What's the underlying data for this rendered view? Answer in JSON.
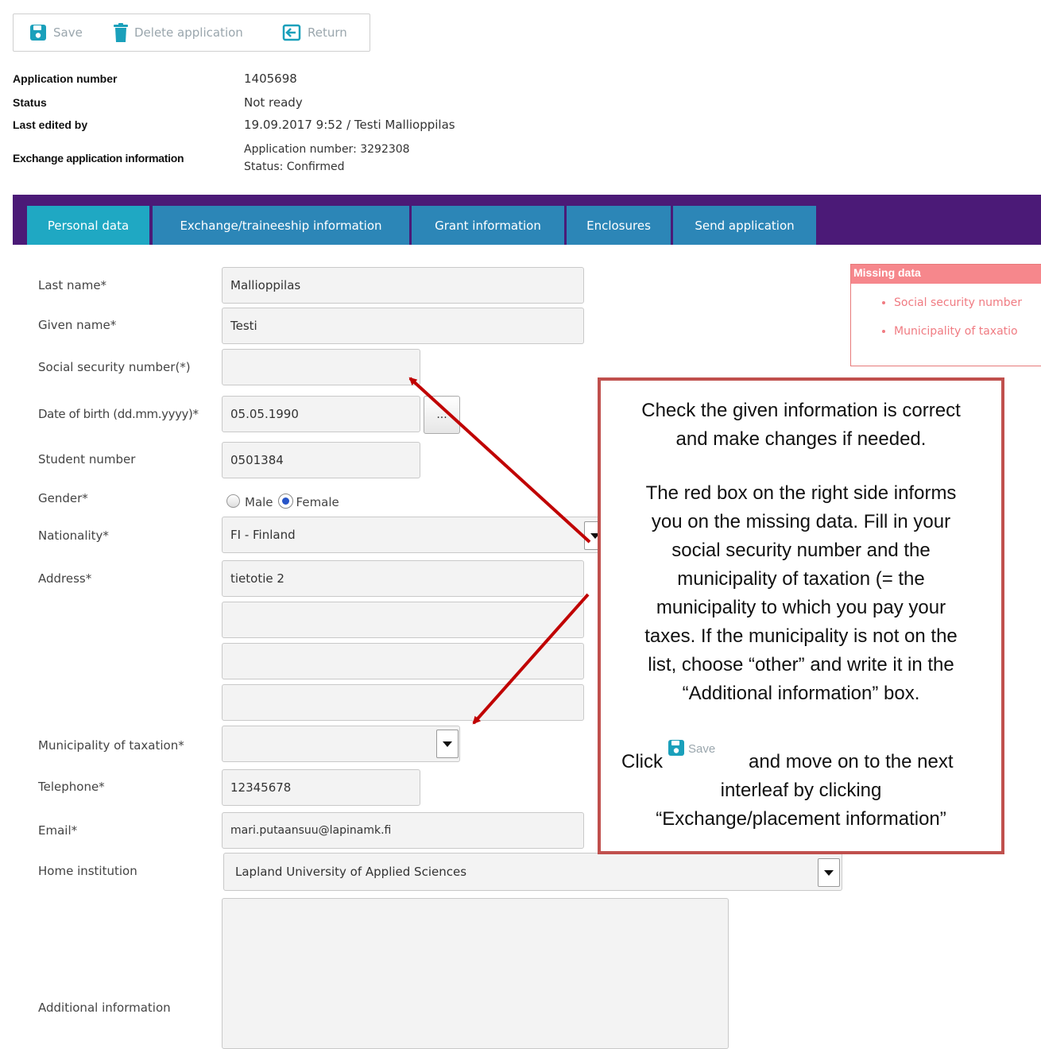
{
  "toolbar": {
    "save_label": "Save",
    "delete_label": "Delete application",
    "return_label": "Return"
  },
  "info": {
    "application_number_label": "Application number",
    "application_number_value": "1405698",
    "status_label": "Status",
    "status_value": "Not ready",
    "last_edited_label": "Last edited by",
    "last_edited_value": "19.09.2017 9:52 / Testi Mallioppilas",
    "exchange_label": "Exchange application information",
    "exchange_app_number": "Application number: 3292308",
    "exchange_status": "Status: Confirmed"
  },
  "tabs": [
    {
      "label": "Personal data"
    },
    {
      "label": "Exchange/traineeship information"
    },
    {
      "label": "Grant information"
    },
    {
      "label": "Enclosures"
    },
    {
      "label": "Send application"
    }
  ],
  "form": {
    "last_name_label": "Last name*",
    "last_name_value": "Mallioppilas",
    "given_name_label": "Given name*",
    "given_name_value": "Testi",
    "ssn_label": "Social security number(*)",
    "ssn_value": "",
    "dob_label": "Date of birth (dd.mm.yyyy)*",
    "dob_value": "05.05.1990",
    "dob_button": "...",
    "student_number_label": "Student number",
    "student_number_value": "0501384",
    "gender_label": "Gender*",
    "gender_male": "Male",
    "gender_female": "Female",
    "gender_selected": "Female",
    "nationality_label": "Nationality*",
    "nationality_value": "FI - Finland",
    "address_label": "Address*",
    "address_line1": "tietotie 2",
    "address_line2": "",
    "address_line3": "",
    "address_line4": "",
    "municipality_label": "Municipality of taxation*",
    "municipality_value": "",
    "telephone_label": "Telephone*",
    "telephone_value": "12345678",
    "email_label": "Email*",
    "email_value": "mari.putaansuu@lapinamk.fi",
    "home_institution_label": "Home institution",
    "home_institution_value": "Lapland University of Applied Sciences",
    "additional_info_label": "Additional information",
    "additional_info_value": ""
  },
  "missing_data": {
    "title": "Missing data",
    "items": [
      "Social security number",
      "Municipality of taxatio"
    ]
  },
  "callout": {
    "p1_line1": "Check the given information is correct",
    "p1_line2": "and make changes if needed.",
    "p2_line1": "The red box on the right side informs",
    "p2_line2": "you on the missing data. Fill in your",
    "p2_line3": "social security number and the",
    "p2_line4": "municipality of taxation (= the",
    "p2_line5": "municipality to which you pay your",
    "p2_line6": "taxes. If the municipality is not on the",
    "p2_line7": "list, choose “other” and write it in the",
    "p2_line8": "“Additional information” box.",
    "click_word": "Click",
    "save_word": "Save",
    "p3_rest": "and move on to the next",
    "p3_line2": "interleaf by clicking",
    "p3_line3": "“Exchange/placement information”"
  },
  "colors": {
    "tabbar": "#4b1a77",
    "tab": "#2c86b7",
    "tab_active": "#1fa8c3",
    "icon": "#1aa0bb",
    "arrow": "#c00000",
    "callout_border": "#c0504d",
    "missing": "#f6878c"
  },
  "icons": {
    "save": "floppy-disk-icon",
    "delete": "trash-icon",
    "return": "return-icon"
  }
}
